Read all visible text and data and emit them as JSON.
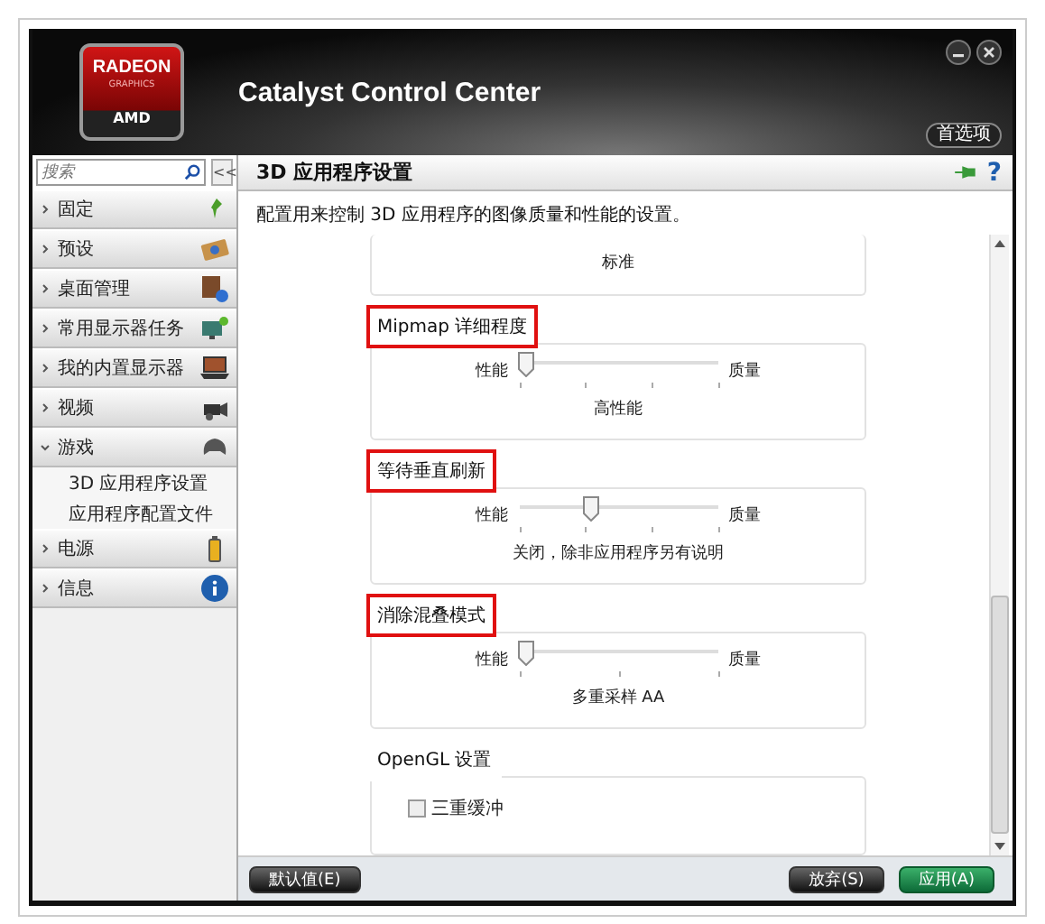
{
  "window": {
    "title": "Catalyst Control Center",
    "logo": {
      "line_1": "RADEON",
      "line_2": "GRAPHICS",
      "line_3": "AMD"
    },
    "preferences_button": "首选项"
  },
  "sidebar": {
    "search": {
      "placeholder": "搜索"
    },
    "collapse": "<<",
    "items": [
      {
        "label": "固定",
        "expanded": false
      },
      {
        "label": "预设",
        "expanded": false
      },
      {
        "label": "桌面管理",
        "expanded": false
      },
      {
        "label": "常用显示器任务",
        "expanded": false
      },
      {
        "label": "我的内置显示器",
        "expanded": false
      },
      {
        "label": "视频",
        "expanded": false
      },
      {
        "label": "游戏",
        "expanded": true,
        "children": [
          {
            "label": "3D 应用程序设置"
          },
          {
            "label": "应用程序配置文件"
          }
        ]
      },
      {
        "label": "电源",
        "expanded": false
      },
      {
        "label": "信息",
        "expanded": false
      }
    ]
  },
  "page": {
    "title": "3D 应用程序设置",
    "help": "?",
    "description": "配置用来控制 3D 应用程序的图像质量和性能的设置。",
    "groups": [
      {
        "kind": "value",
        "value": "标准"
      },
      {
        "kind": "slider",
        "title": "Mipmap 详细程度",
        "highlighted": true,
        "min_label": "性能",
        "max_label": "质量",
        "level": 0,
        "value": "高性能"
      },
      {
        "kind": "slider",
        "title": "等待垂直刷新",
        "highlighted": true,
        "min_label": "性能",
        "max_label": "质量",
        "level": 0.33,
        "value": "关闭，除非应用程序另有说明"
      },
      {
        "kind": "slider",
        "title": "消除混叠模式",
        "highlighted": true,
        "min_label": "性能",
        "max_label": "质量",
        "level": 0,
        "value": "多重采样 AA"
      },
      {
        "kind": "checkbox",
        "title": "OpenGL 设置",
        "highlighted": false,
        "label": "三重缓冲",
        "checked": false
      }
    ]
  },
  "buttons": {
    "defaults": "默认值(E)",
    "discard": "放弃(S)",
    "apply": "应用(A)"
  }
}
